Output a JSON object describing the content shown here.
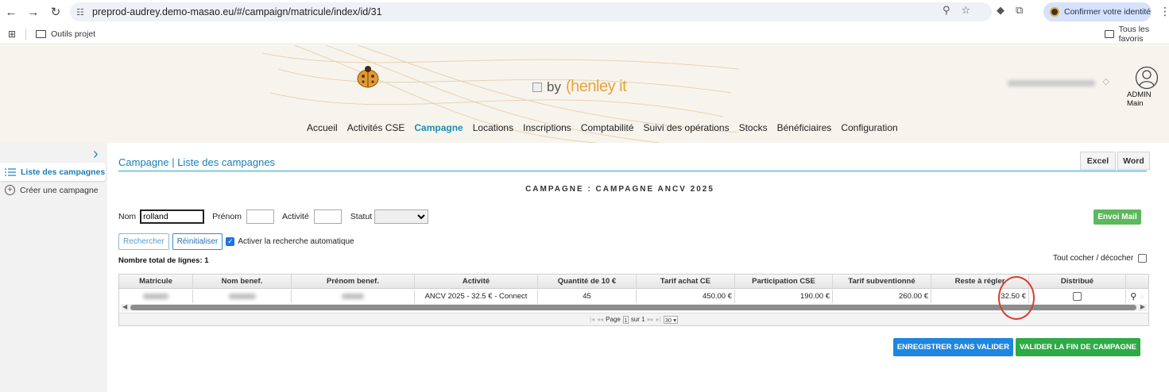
{
  "browser": {
    "url": "preprod-audrey.demo-masao.eu/#/campaign/matricule/index/id/31",
    "identity_label": "Confirmer votre identité",
    "bookmark_folder": "Outils projet",
    "all_bookmarks": "Tous les favoris"
  },
  "header": {
    "logo_prefix": "by",
    "logo_brand": "(henley it",
    "user_label": "ADMIN Main"
  },
  "menu": {
    "items": [
      "Accueil",
      "Activités CSE",
      "Campagne",
      "Locations",
      "Inscriptions",
      "Comptabilité",
      "Suivi des opérations",
      "Stocks",
      "Bénéficiaires",
      "Configuration"
    ],
    "active": "Campagne"
  },
  "sidebar": {
    "items": [
      {
        "label": "Liste des campagnes",
        "icon": "list-icon"
      },
      {
        "label": "Créer une campagne",
        "icon": "plus-circle-icon"
      }
    ]
  },
  "page": {
    "breadcrumb": "Campagne | Liste des campagnes",
    "export_excel": "Excel",
    "export_word": "Word",
    "campaign_title": "Campagne : CAMPAGNE ANCV 2025"
  },
  "filters": {
    "nom_label": "Nom",
    "nom_value": "rolland",
    "prenom_label": "Prénom",
    "prenom_value": "",
    "activite_label": "Activité",
    "activite_value": "",
    "statut_label": "Statut",
    "statut_value": "",
    "envoi_mail": "Envoi Mail",
    "rechercher": "Rechercher",
    "reinitialiser": "Réinitialiser",
    "auto_search_label": "Activer la recherche automatique",
    "total_lines": "Nombre total de lignes: 1",
    "tout_cocher": "Tout cocher / décocher"
  },
  "grid": {
    "columns": [
      "Matricule",
      "Nom benef.",
      "Prénom benef.",
      "Activité",
      "Quantité de 10 €",
      "Tarif achat CE",
      "Participation CSE",
      "Tarif subventionné",
      "Reste à régler",
      "Distribué"
    ],
    "rows": [
      {
        "activite": "ANCV 2025 - 32.5 € - Connect",
        "quantite": "45",
        "tarif_achat": "450.00 €",
        "participation": "190.00 €",
        "tarif_subv": "260.00 €",
        "reste": "32.50 €"
      }
    ],
    "pager": {
      "page_label": "Page",
      "page_value": "1",
      "of_label": "sur 1",
      "per_page": "30"
    }
  },
  "actions": {
    "save_no_validate": "ENREGISTRER SANS VALIDER",
    "validate_end": "VALIDER LA FIN DE CAMPAGNE"
  },
  "colors": {
    "accent": "#1a8fb0",
    "blue_button": "#1f86e0",
    "green_button": "#2eaa46",
    "highlight": "#d6402e"
  }
}
